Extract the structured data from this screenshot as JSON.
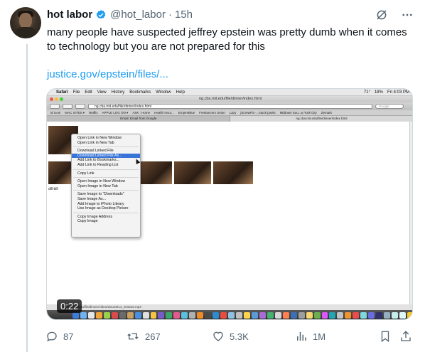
{
  "author": {
    "display_name": "hot labor",
    "handle": "@hot_labor",
    "separator": "·",
    "time": "15h"
  },
  "tweet": {
    "text": "many people have suspected jeffrey epstein was pretty dumb when it comes to technology but you are not prepared for this",
    "link": "justice.gov/epstein/files/..."
  },
  "media": {
    "video_timestamp": "0:22",
    "screen": {
      "menubar": [
        "Safari",
        "File",
        "Edit",
        "View",
        "History",
        "Bookmarks",
        "Window",
        "Help"
      ],
      "menubar_right": [
        "71°",
        "18%",
        "Fri 4:03 PM"
      ],
      "title": "ng.cba.mit.edu/file/dinner/index.html",
      "address": "ng.cba.mit.edu/file/dinner/index.html",
      "search_placeholder": "Google",
      "bookmarks": [
        "id Iconi",
        "MAC SITES ▾",
        "Netflix",
        "APPLE LOG ON ▾",
        "ASK : Home",
        "Health Insur...",
        "EmpireBlue",
        "Freelancers Union",
        "Lazy",
        "jScrewFix -...stuck pixels",
        "Midtown Sou...w York City",
        "Zemark"
      ],
      "tabs": [
        "Gmail: Email from Google",
        "ng.cba.mit.edu/file/dinner/index.html"
      ],
      "thumb_label": "dill bill",
      "context_menu": [
        "Open Link in New Window",
        "Open Link in New Tab",
        "---",
        "Download Linked File",
        "Download Linked File As...",
        "Add Link to Bookmarks...",
        "Add Link to Reading List",
        "---",
        "Copy Link",
        "---",
        "Open Image in New Window",
        "Open Image in New Tab",
        "---",
        "Save Image to \"Downloads\"",
        "Save Image As...",
        "Add Image to iPhoto Library",
        "Use Image as Desktop Picture",
        "---",
        "Copy Image Address",
        "Copy Image"
      ],
      "highlighted_item": "Download Linked File As...",
      "status_text": "ng.cba.mit.edu/file/dinner/video/20110914_101815.mp4"
    }
  },
  "stats": {
    "replies": "87",
    "reposts": "267",
    "likes": "5.3K",
    "views": "1M"
  },
  "colors": {
    "link": "#1d9bf0",
    "secondary": "#536471",
    "verified": "#1d9bf0"
  }
}
